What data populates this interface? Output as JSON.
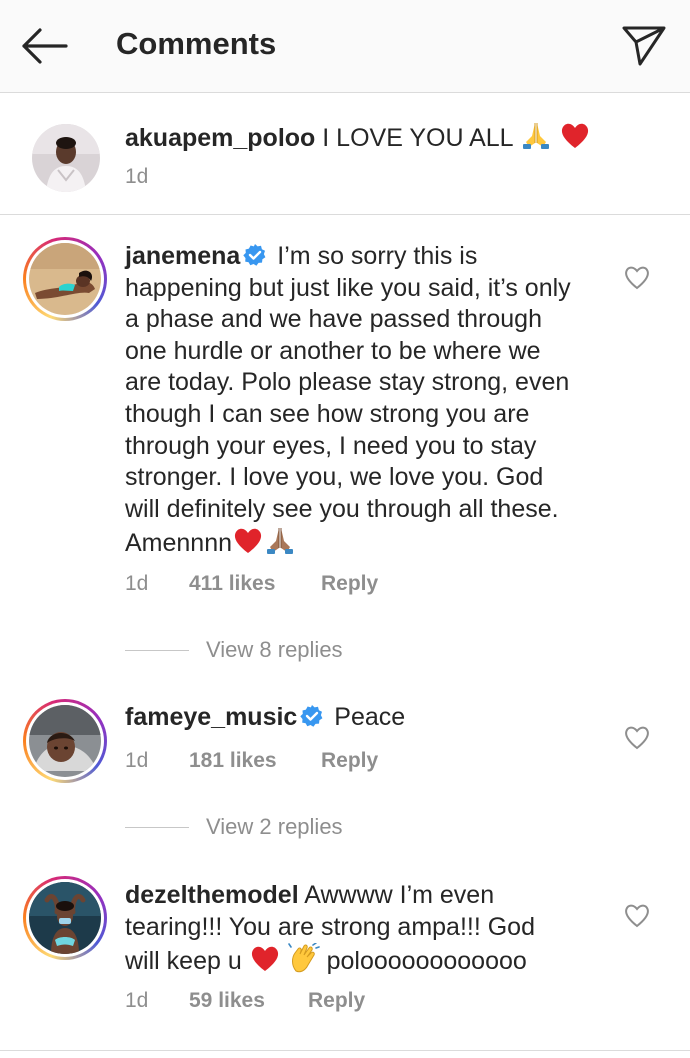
{
  "header": {
    "title": "Comments"
  },
  "caption": {
    "username": "akuapem_poloo",
    "text": "I LOVE YOU ALL",
    "time": "1d"
  },
  "comments": [
    {
      "username": "janemena",
      "verified": true,
      "text_lines": [
        "I’m so sorry this is",
        "happening but just like you said, it’s only",
        "a phase and we have passed through",
        "one hurdle or another to be where we",
        "are today. Polo please stay strong, even",
        "though I can see how strong you are",
        "through your eyes, I need you to stay",
        "stronger. I love you, we love you. God",
        "will definitely see you through all these.",
        "Amennnn"
      ],
      "time": "1d",
      "likes": "411 likes",
      "reply": "Reply",
      "view_replies": "View 8 replies"
    },
    {
      "username": "fameye_music",
      "verified": true,
      "text_lines": [
        "Peace"
      ],
      "time": "1d",
      "likes": "181 likes",
      "reply": "Reply",
      "view_replies": "View 2 replies"
    },
    {
      "username": "dezelthemodel",
      "verified": false,
      "text_lines": [
        "Awwww I’m even",
        "tearing!!! You are strong ampa!!! God",
        "will keep u",
        "poloooooooooooo"
      ],
      "time": "1d",
      "likes": "59 likes",
      "reply": "Reply"
    }
  ],
  "colors": {
    "text": "#262626",
    "secondary": "#8e8e8e",
    "verified": "#3897f0",
    "heart_emoji": "#e0242b",
    "divider": "#dbdbdb"
  },
  "icons": {
    "back": "arrow-left-icon",
    "send": "paper-plane-icon",
    "like": "heart-outline-icon",
    "verified": "verified-badge-icon",
    "emoji_pray": "folded-hands-emoji",
    "emoji_heart": "red-heart-emoji",
    "emoji_clap": "waving-hand-emoji"
  }
}
